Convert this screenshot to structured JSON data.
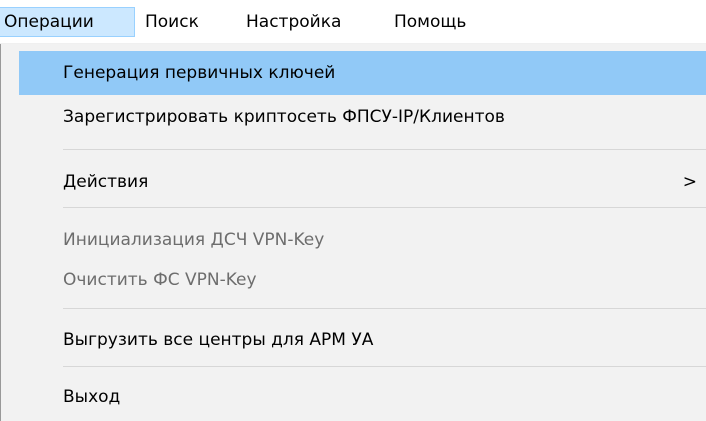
{
  "menubar": {
    "items": [
      {
        "label": "Операции",
        "active": true
      },
      {
        "label": "Поиск"
      },
      {
        "label": "Настройка"
      },
      {
        "label": "Помощь"
      }
    ]
  },
  "dropdown": {
    "items": [
      {
        "label": "Генерация первичных ключей",
        "state": "highlighted"
      },
      {
        "label": "Зарегистрировать криптосеть ФПСУ-IP/Клиентов"
      },
      {
        "label": "Действия",
        "submenu_glyph": ">"
      },
      {
        "label": "Инициализация ДСЧ VPN-Key",
        "state": "disabled"
      },
      {
        "label": "Очистить ФС VPN-Key",
        "state": "disabled"
      },
      {
        "label": "Выгрузить все центры для АРМ УА"
      },
      {
        "label": "Выход"
      }
    ]
  },
  "colors": {
    "highlight": "#91c9f7",
    "menubar_active": "#cce8ff",
    "menu_background": "#f2f2f2",
    "disabled_text": "#6d6d6d"
  }
}
